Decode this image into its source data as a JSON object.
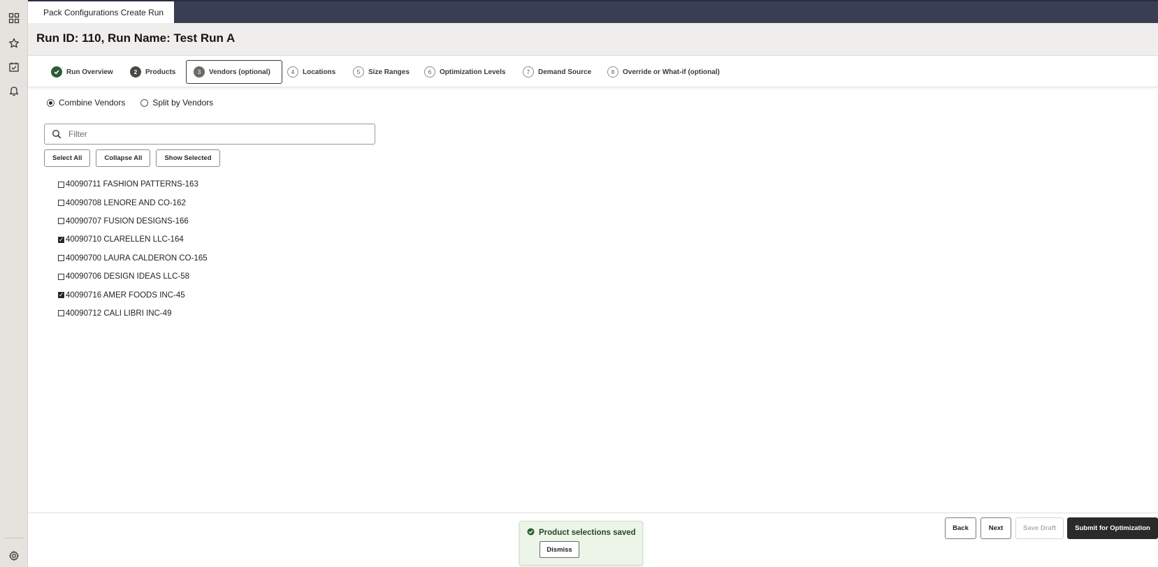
{
  "rail": {
    "icons": [
      "grid-icon",
      "star-icon",
      "task-check-icon",
      "bell-icon",
      "gear-icon"
    ]
  },
  "tab": {
    "label": "Pack Configurations Create Run"
  },
  "header": {
    "title": "Run ID: 110, Run Name: Test Run A"
  },
  "train": {
    "steps": [
      {
        "num": "",
        "label": "Run Overview",
        "state": "done"
      },
      {
        "num": "2",
        "label": "Products",
        "state": "visited"
      },
      {
        "num": "3",
        "label": "Vendors (optional)",
        "state": "current"
      },
      {
        "num": "4",
        "label": "Locations",
        "state": "pending"
      },
      {
        "num": "5",
        "label": "Size Ranges",
        "state": "pending"
      },
      {
        "num": "6",
        "label": "Optimization Levels",
        "state": "pending"
      },
      {
        "num": "7",
        "label": "Demand Source",
        "state": "pending"
      },
      {
        "num": "8",
        "label": "Override or What-if (optional)",
        "state": "pending"
      }
    ]
  },
  "vendor_mode": {
    "options": [
      {
        "label": "Combine Vendors",
        "selected": true
      },
      {
        "label": "Split by Vendors",
        "selected": false
      }
    ]
  },
  "filter": {
    "placeholder": "Filter",
    "value": ""
  },
  "actions": {
    "select_all": "Select All",
    "collapse_all": "Collapse All",
    "show_selected": "Show Selected"
  },
  "vendors": [
    {
      "label": "40090711 FASHION PATTERNS-163",
      "checked": false
    },
    {
      "label": "40090708 LENORE AND CO-162",
      "checked": false
    },
    {
      "label": "40090707 FUSION DESIGNS-166",
      "checked": false
    },
    {
      "label": "40090710 CLARELLEN LLC-164",
      "checked": true
    },
    {
      "label": "40090700 LAURA CALDERON CO-165",
      "checked": false
    },
    {
      "label": "40090706 DESIGN IDEAS LLC-58",
      "checked": false
    },
    {
      "label": "40090716 AMER FOODS INC-45",
      "checked": true
    },
    {
      "label": "40090712 CALI LIBRI INC-49",
      "checked": false
    }
  ],
  "toast": {
    "message": "Product selections saved",
    "dismiss": "Dismiss",
    "color": "#24492a"
  },
  "footer": {
    "back": "Back",
    "next": "Next",
    "save_draft": "Save Draft",
    "submit": "Submit for Optimization"
  }
}
